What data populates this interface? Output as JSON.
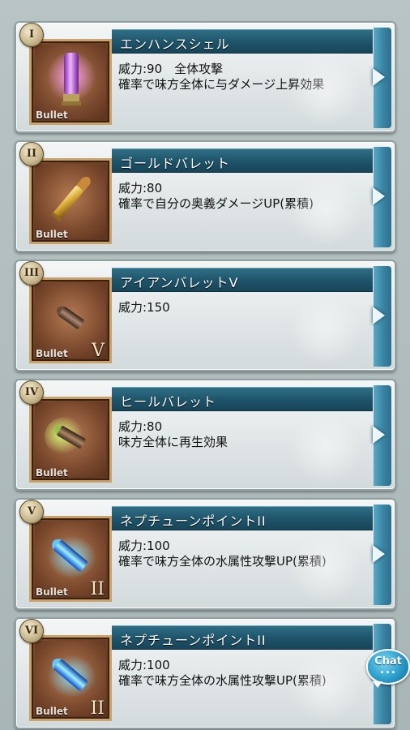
{
  "bullets": [
    {
      "slot": "I",
      "name": "エンハンスシェル",
      "line1": "威力:90　全体攻撃",
      "line2": "確率で味方全体に与ダメージ上昇効果",
      "type_tag": "Bullet",
      "level": "",
      "icon": "purple-shell-icon"
    },
    {
      "slot": "II",
      "name": "ゴールドバレット",
      "line1": "威力:80",
      "line2": "確率で自分の奥義ダメージUP(累積)",
      "type_tag": "Bullet",
      "level": "",
      "icon": "gold-bullet-icon"
    },
    {
      "slot": "III",
      "name": "アイアンバレットⅤ",
      "line1": "威力:150",
      "line2": "",
      "type_tag": "Bullet",
      "level": "V",
      "icon": "iron-bullet-icon"
    },
    {
      "slot": "IV",
      "name": "ヒールバレット",
      "line1": "威力:80",
      "line2": "味方全体に再生効果",
      "type_tag": "Bullet",
      "level": "",
      "icon": "heal-bullet-icon"
    },
    {
      "slot": "V",
      "name": "ネプチューンポイントII",
      "line1": "威力:100",
      "line2": "確率で味方全体の水属性攻撃UP(累積)",
      "type_tag": "Bullet",
      "level": "II",
      "icon": "blue-bullet-icon"
    },
    {
      "slot": "VI",
      "name": "ネプチューンポイントII",
      "line1": "威力:100",
      "line2": "確率で味方全体の水属性攻撃UP(累積)",
      "type_tag": "Bullet",
      "level": "II",
      "icon": "blue-bullet-icon"
    }
  ],
  "chat": {
    "label": "Chat",
    "dots": "•••"
  },
  "colors": {
    "name_bar": "#1e5369",
    "side_strip": "#3b86a6",
    "icon_frame": "#c9a36b"
  }
}
